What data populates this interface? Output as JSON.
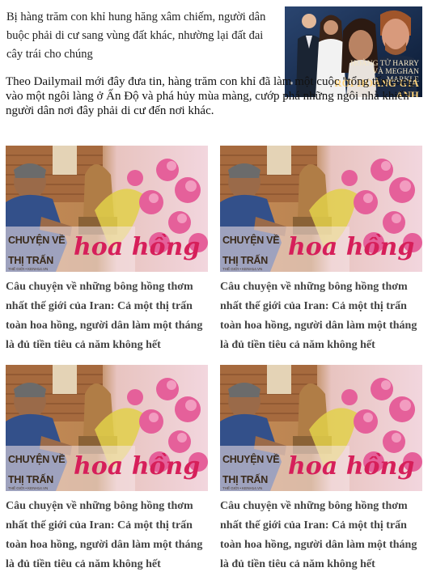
{
  "top_story": {
    "headline": "Bị hàng trăm con khỉ hung hăng xâm chiếm, người dân buộc phải di cư sang vùng đất khác, nhường lại đất đai cây trái cho chúng",
    "image": {
      "caption_names": "HOÀNG TỬ HARRY VÀ MEGHAN MARKLE",
      "caption_action": "RỜI HOÀNG GIA ANH",
      "bg_color": "#0f2240"
    }
  },
  "lead_paragraph": "Theo Dailymail mới đây đưa tin, hàng trăm con khỉ đã làm một cuộc \"tổng tấn công\" vào một ngôi làng ở Ấn Độ và phá hủy mùa màng, cướp phá những ngôi nhà khiến người dân nơi đây phải di cư đến nơi khác.",
  "related_articles": [
    {
      "title": "Câu chuyện về những bông hồng thơm nhất thế giới của Iran: Cả một thị trấn toàn hoa hồng, người dân làm một tháng là đủ tiền tiêu cả năm không hết",
      "thumb": {
        "line1": "CHUYỆN VỀ",
        "line2": "THỊ TRẤN",
        "script": "hoa hồng",
        "credit": "THẾ GIỚI • KENH14.VN"
      }
    },
    {
      "title": "Câu chuyện về những bông hồng thơm nhất thế giới của Iran: Cả một thị trấn toàn hoa hồng, người dân làm một tháng là đủ tiền tiêu cả năm không hết",
      "thumb": {
        "line1": "CHUYỆN VỀ",
        "line2": "THỊ TRẤN",
        "script": "hoa hồng",
        "credit": "THẾ GIỚI • KENH14.VN"
      }
    },
    {
      "title": "Câu chuyện về những bông hồng thơm nhất thế giới của Iran: Cả một thị trấn toàn hoa hồng, người dân làm một tháng là đủ tiền tiêu cả năm không hết",
      "thumb": {
        "line1": "CHUYỆN VỀ",
        "line2": "THỊ TRẤN",
        "script": "hoa hồng",
        "credit": "THẾ GIỚI • KENH14.VN"
      }
    },
    {
      "title": "Câu chuyện về những bông hồng thơm nhất thế giới của Iran: Cả một thị trấn toàn hoa hồng, người dân làm một tháng là đủ tiền tiêu cả năm không hết",
      "thumb": {
        "line1": "CHUYỆN VỀ",
        "line2": "THỊ TRẤN",
        "script": "hoa hồng",
        "credit": "THẾ GIỚI • KENH14.VN"
      }
    }
  ],
  "colors": {
    "headline_text": "#222222",
    "card_title_text": "#444444",
    "script_pink": "#d61f5a"
  }
}
